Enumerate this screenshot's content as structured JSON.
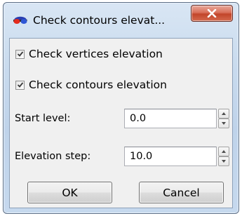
{
  "window": {
    "title": "Check contours elevat...",
    "close_glyph": "X",
    "icon": "red-blue-stereo-glasses-icon"
  },
  "checkboxes": [
    {
      "label": "Check vertices elevation",
      "checked": true
    },
    {
      "label": "Check contours elevation",
      "checked": true
    }
  ],
  "fields": {
    "start_level": {
      "label": "Start level:",
      "value": "0.0"
    },
    "elevation_step": {
      "label": "Elevation step:",
      "value": "10.0"
    }
  },
  "buttons": {
    "ok": "OK",
    "cancel": "Cancel"
  },
  "colors": {
    "close_button": "#c94a30",
    "client_bg": "#f0f0f0",
    "frame": "#c3d6ec"
  }
}
